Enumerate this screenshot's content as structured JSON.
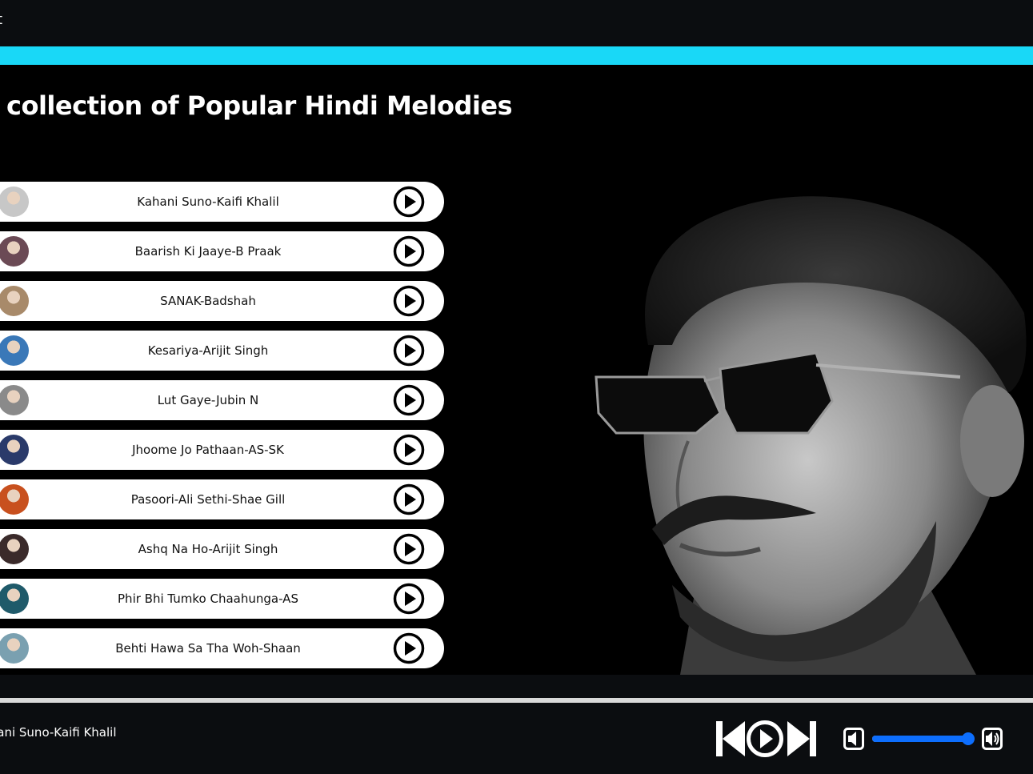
{
  "header": {
    "title_fragment": "t"
  },
  "page": {
    "title": "collection of Popular Hindi Melodies"
  },
  "songs": [
    {
      "label": "Kahani Suno-Kaifi Khalil",
      "avatar_color": "#c7c7c7"
    },
    {
      "label": "Baarish Ki Jaaye-B Praak",
      "avatar_color": "#6b4a55"
    },
    {
      "label": "SANAK-Badshah",
      "avatar_color": "#a88a6a"
    },
    {
      "label": "Kesariya-Arijit Singh",
      "avatar_color": "#3a78b8"
    },
    {
      "label": "Lut Gaye-Jubin N",
      "avatar_color": "#8a8a8a"
    },
    {
      "label": "Jhoome Jo Pathaan-AS-SK",
      "avatar_color": "#2a3a6a"
    },
    {
      "label": "Pasoori-Ali Sethi-Shae Gill",
      "avatar_color": "#c8501e"
    },
    {
      "label": "Ashq Na Ho-Arijit Singh",
      "avatar_color": "#3a2a2a"
    },
    {
      "label": "Phir Bhi Tumko Chaahunga-AS",
      "avatar_color": "#1f5a6a"
    },
    {
      "label": "Behti Hawa Sa Tha Woh-Shaan",
      "avatar_color": "#7aa0b0"
    }
  ],
  "player": {
    "now_playing": "Kahani Suno-Kaifi Khalil",
    "volume_fraction": 0.98
  },
  "icons": {
    "play": "play-circle-icon",
    "previous": "skip-previous-icon",
    "next": "skip-next-icon",
    "volume_mute": "volume-mute-icon",
    "volume_up": "volume-up-icon"
  },
  "colors": {
    "accent": "#19d8f7",
    "volume": "#0d6efd"
  }
}
